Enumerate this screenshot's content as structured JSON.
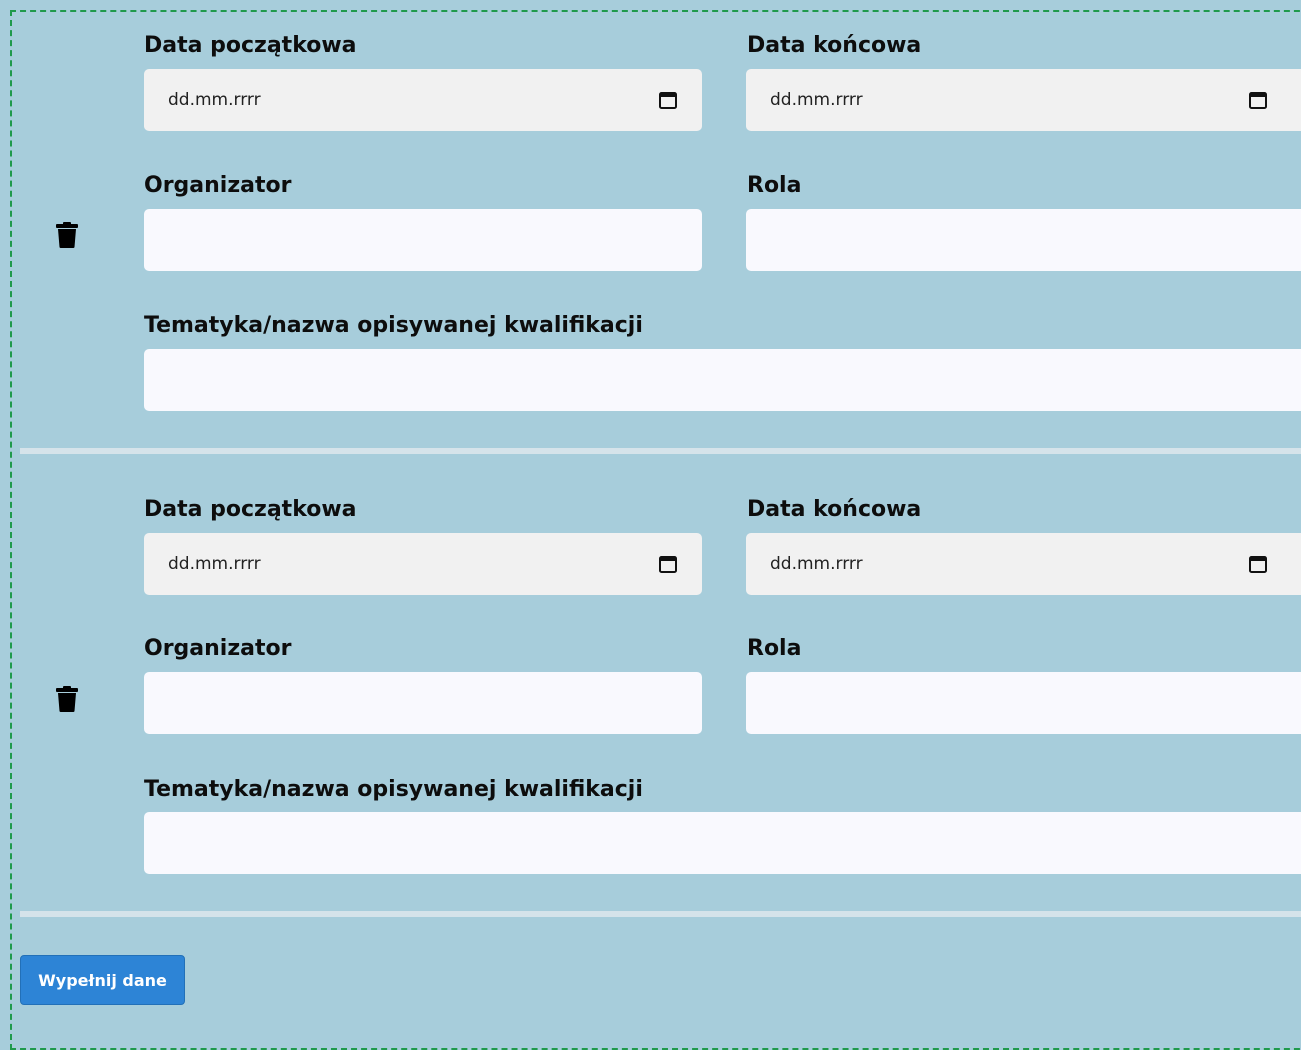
{
  "entries": [
    {
      "start_date_label": "Data początkowa",
      "start_date_placeholder": "dd.mm.rrrr",
      "end_date_label": "Data końcowa",
      "end_date_placeholder": "dd.mm.rrrr",
      "organizer_label": "Organizator",
      "organizer_value": "",
      "role_label": "Rola",
      "role_value": "",
      "topic_label": "Tematyka/nazwa opisywanej kwalifikacji",
      "topic_value": "",
      "delete_icon": "trash-icon"
    },
    {
      "start_date_label": "Data początkowa",
      "start_date_placeholder": "dd.mm.rrrr",
      "end_date_label": "Data końcowa",
      "end_date_placeholder": "dd.mm.rrrr",
      "organizer_label": "Organizator",
      "organizer_value": "",
      "role_label": "Rola",
      "role_value": "",
      "topic_label": "Tematyka/nazwa opisywanej kwalifikacji",
      "topic_value": "",
      "delete_icon": "trash-icon"
    }
  ],
  "fill_button_label": "Wypełnij dane",
  "colors": {
    "background": "#a7cddb",
    "button": "#2d84d6",
    "frame_border": "#1f9a4c"
  }
}
